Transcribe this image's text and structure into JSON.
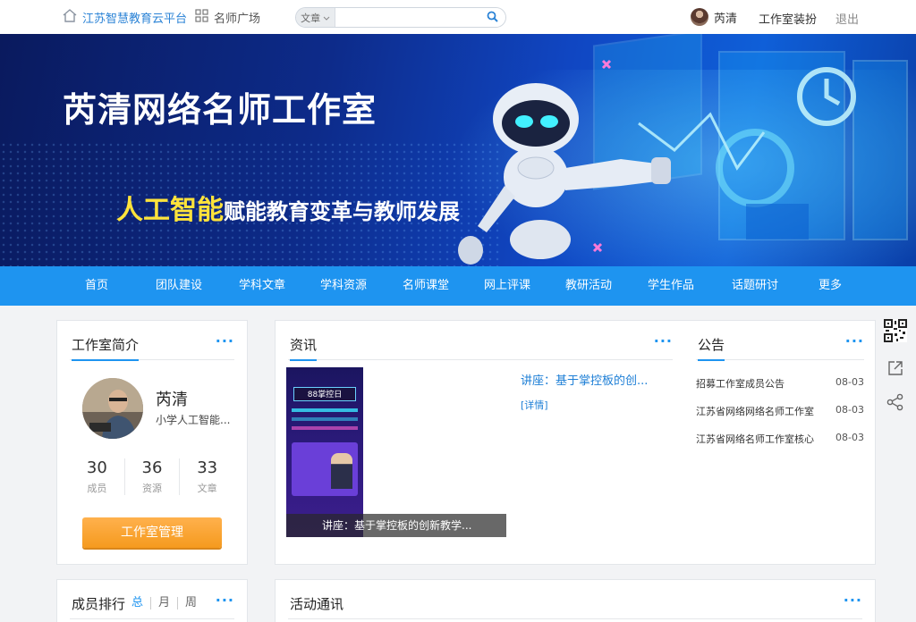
{
  "topbar": {
    "platform": "江苏智慧教育云平台",
    "plaza": "名师广场",
    "search_type": "文章",
    "search_placeholder": "",
    "user": "芮清",
    "decorate": "工作室装扮",
    "exit": "退出"
  },
  "banner": {
    "title": "芮清网络名师工作室",
    "sub_highlight": "人工智能",
    "sub_rest": "赋能教育变革与教师发展"
  },
  "nav": [
    "首页",
    "团队建设",
    "学科文章",
    "学科资源",
    "名师课堂",
    "网上评课",
    "教研活动",
    "学生作品",
    "话题研讨",
    "更多"
  ],
  "intro": {
    "title": "工作室简介",
    "more": "···",
    "name": "芮清",
    "desc": "小学人工智能...",
    "stats": [
      {
        "num": "30",
        "label": "成员"
      },
      {
        "num": "36",
        "label": "资源"
      },
      {
        "num": "33",
        "label": "文章"
      }
    ],
    "manage": "工作室管理"
  },
  "news": {
    "title": "资讯",
    "more": "···",
    "item_title": "讲座：基于掌控板的创...",
    "detail": "[详情]",
    "caption": "讲座：基于掌控板的创新教学...",
    "poster_title": "88掌控日"
  },
  "notice": {
    "title": "公告",
    "more": "···",
    "items": [
      {
        "text": "招募工作室成员公告",
        "date": "08-03"
      },
      {
        "text": "江苏省网络网络名师工作室",
        "date": "08-03"
      },
      {
        "text": "江苏省网络名师工作室核心",
        "date": "08-03"
      }
    ]
  },
  "rank": {
    "title": "成员排行",
    "more": "···",
    "tabs": [
      "总",
      "月",
      "周"
    ]
  },
  "activity": {
    "title": "活动通讯",
    "more": "···"
  },
  "colors": {
    "nav": "#1e94f0",
    "accent": "#ffe33b",
    "button": "#f59a1e"
  }
}
